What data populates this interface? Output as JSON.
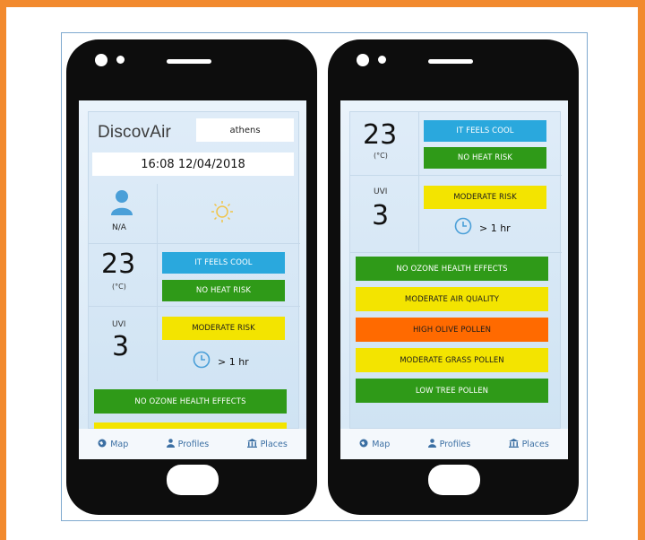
{
  "colors": {
    "frame": "#f28a2e",
    "blue": "#2aa8dd",
    "green": "#2f9a18",
    "yellow": "#f3e400",
    "orange": "#ff6a00",
    "icon_blue": "#4a9fd8"
  },
  "left_phone": {
    "logo": "DiscovAir",
    "city": "athens",
    "datetime": "16:08 12/04/2018",
    "profile_value": "N/A",
    "temperature": "23",
    "temperature_unit": "(°C)",
    "feels_label": "IT FEELS COOL",
    "heat_label": "NO HEAT RISK",
    "uvi_label": "UVI",
    "uvi_value": "3",
    "uv_risk_label": "MODERATE RISK",
    "time_label": "> 1 hr",
    "ozone_label": "NO OZONE HEALTH EFFECTS",
    "nav": {
      "map": "Map",
      "profiles": "Profiles",
      "places": "Places"
    }
  },
  "right_phone": {
    "temperature": "23",
    "temperature_unit": "(°C)",
    "feels_label": "IT FEELS COOL",
    "heat_label": "NO HEAT RISK",
    "uvi_label": "UVI",
    "uvi_value": "3",
    "uv_risk_label": "MODERATE RISK",
    "time_label": "> 1 hr",
    "indicators": [
      {
        "label": "NO OZONE HEALTH EFFECTS",
        "color": "#2f9a18"
      },
      {
        "label": "MODERATE AIR QUALITY",
        "color": "#f3e400"
      },
      {
        "label": "HIGH OLIVE POLLEN",
        "color": "#ff6a00"
      },
      {
        "label": "MODERATE GRASS POLLEN",
        "color": "#f3e400"
      },
      {
        "label": "LOW TREE POLLEN",
        "color": "#2f9a18"
      }
    ],
    "nav": {
      "map": "Map",
      "profiles": "Profiles",
      "places": "Places"
    }
  }
}
